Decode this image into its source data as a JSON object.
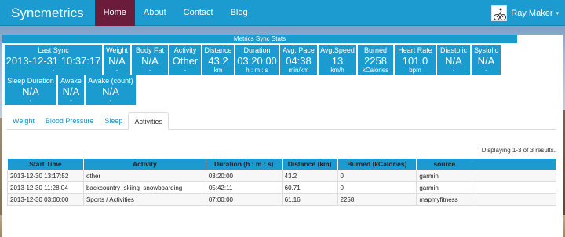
{
  "navbar": {
    "brand": "Syncmetrics",
    "items": [
      {
        "label": "Home",
        "active": true
      },
      {
        "label": "About",
        "active": false
      },
      {
        "label": "Contact",
        "active": false
      },
      {
        "label": "Blog",
        "active": false
      }
    ],
    "user": {
      "name": "Ray Maker",
      "caret": "▾"
    }
  },
  "stats": {
    "title": "Metrics Sync Stats",
    "row1": [
      {
        "label": "Last Sync",
        "value": "2013-12-31 10:37:17",
        "unit": "-"
      },
      {
        "label": "Weight",
        "value": "N/A",
        "unit": "-"
      },
      {
        "label": "Body Fat",
        "value": "N/A",
        "unit": "-"
      },
      {
        "label": "Activity",
        "value": "Other",
        "unit": "-"
      },
      {
        "label": "Distance",
        "value": "43.2",
        "unit": "km"
      },
      {
        "label": "Duration",
        "value": "03:20:00",
        "unit": "h : m : s"
      },
      {
        "label": "Avg. Pace",
        "value": "04:38",
        "unit": "min/km"
      },
      {
        "label": "Avg.Speed",
        "value": "13",
        "unit": "km/h"
      },
      {
        "label": "Burned",
        "value": "2258",
        "unit": "kCalories"
      },
      {
        "label": "Heart Rate",
        "value": "101.0",
        "unit": "bpm"
      },
      {
        "label": "Diastolic",
        "value": "N/A",
        "unit": "-"
      },
      {
        "label": "Systolic",
        "value": "N/A",
        "unit": "-"
      }
    ],
    "row2": [
      {
        "label": "Sleep Duration",
        "value": "N/A",
        "unit": "-"
      },
      {
        "label": "Awake",
        "value": "N/A",
        "unit": "-"
      },
      {
        "label": "Awake (count)",
        "value": "N/A",
        "unit": "-"
      }
    ]
  },
  "tabs": [
    {
      "label": "Weight",
      "active": false
    },
    {
      "label": "Blood Pressure",
      "active": false
    },
    {
      "label": "Sleep",
      "active": false
    },
    {
      "label": "Activities",
      "active": true
    }
  ],
  "results_summary": "Displaying 1-3 of 3 results.",
  "table": {
    "columns": [
      "Start Time",
      "Activity",
      "Duration (h : m : s)",
      "Distance (km)",
      "Burned (kCalories)",
      "source",
      ""
    ],
    "rows": [
      [
        "2013-12-30 13:17:52",
        "other",
        "03:20:00",
        "43.2",
        "0",
        "garmin",
        ""
      ],
      [
        "2013-12-30 11:28:04",
        "backcountry_skiing_snowboarding",
        "05:42:11",
        "60.71",
        "0",
        "garmin",
        ""
      ],
      [
        "2013-12-30 03:00:00",
        "Sports / Activities",
        "07:00:00",
        "61.16",
        "2258",
        "mapmyfitness",
        ""
      ]
    ]
  },
  "colors": {
    "primary": "#1c9bd0",
    "nav_active": "#6b1c3b"
  }
}
